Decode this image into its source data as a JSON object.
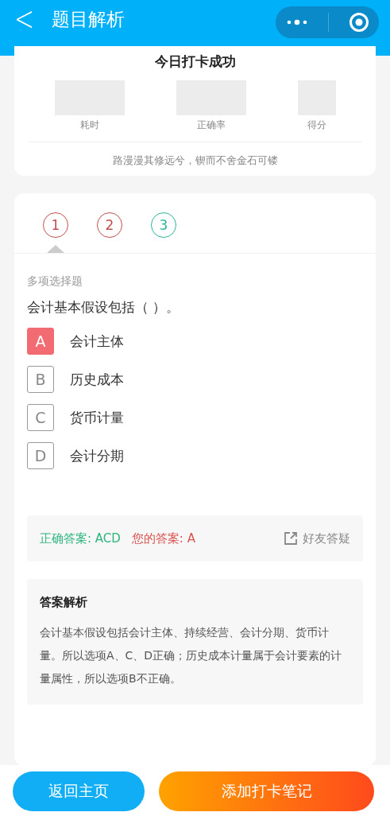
{
  "header": {
    "back": "<",
    "title": "题目解析"
  },
  "summary": {
    "title": "今日打卡成功",
    "stats": [
      {
        "label": "耗时"
      },
      {
        "label": "正确率"
      },
      {
        "label": "得分"
      }
    ],
    "motto": "路漫漫其修远兮，锲而不舍金石可镂"
  },
  "question_tabs": [
    {
      "label": "1",
      "correct": false,
      "selected": true
    },
    {
      "label": "2",
      "correct": false,
      "selected": false
    },
    {
      "label": "3",
      "correct": true,
      "selected": false
    }
  ],
  "question": {
    "type": "多项选择题",
    "text": "会计基本假设包括（   ）。",
    "options": [
      {
        "letter": "A",
        "text": "会计主体",
        "selected": true
      },
      {
        "letter": "B",
        "text": "历史成本",
        "selected": false
      },
      {
        "letter": "C",
        "text": "货币计量",
        "selected": false
      },
      {
        "letter": "D",
        "text": "会计分期",
        "selected": false
      }
    ]
  },
  "answer": {
    "correct": "正确答案: ACD",
    "yours": "您的答案: A",
    "ask_friend": "好友答疑"
  },
  "explanation": {
    "title": "答案解析",
    "text": "会计基本假设包括会计主体、持续经营、会计分期、货币计量。所以选项A、C、D正确；历史成本计量属于会计要素的计量属性，所以选项B不正确。"
  },
  "buttons": [
    {
      "label": "返回主页",
      "kind": "home"
    },
    {
      "label": "添加打卡笔记",
      "kind": "note"
    }
  ]
}
